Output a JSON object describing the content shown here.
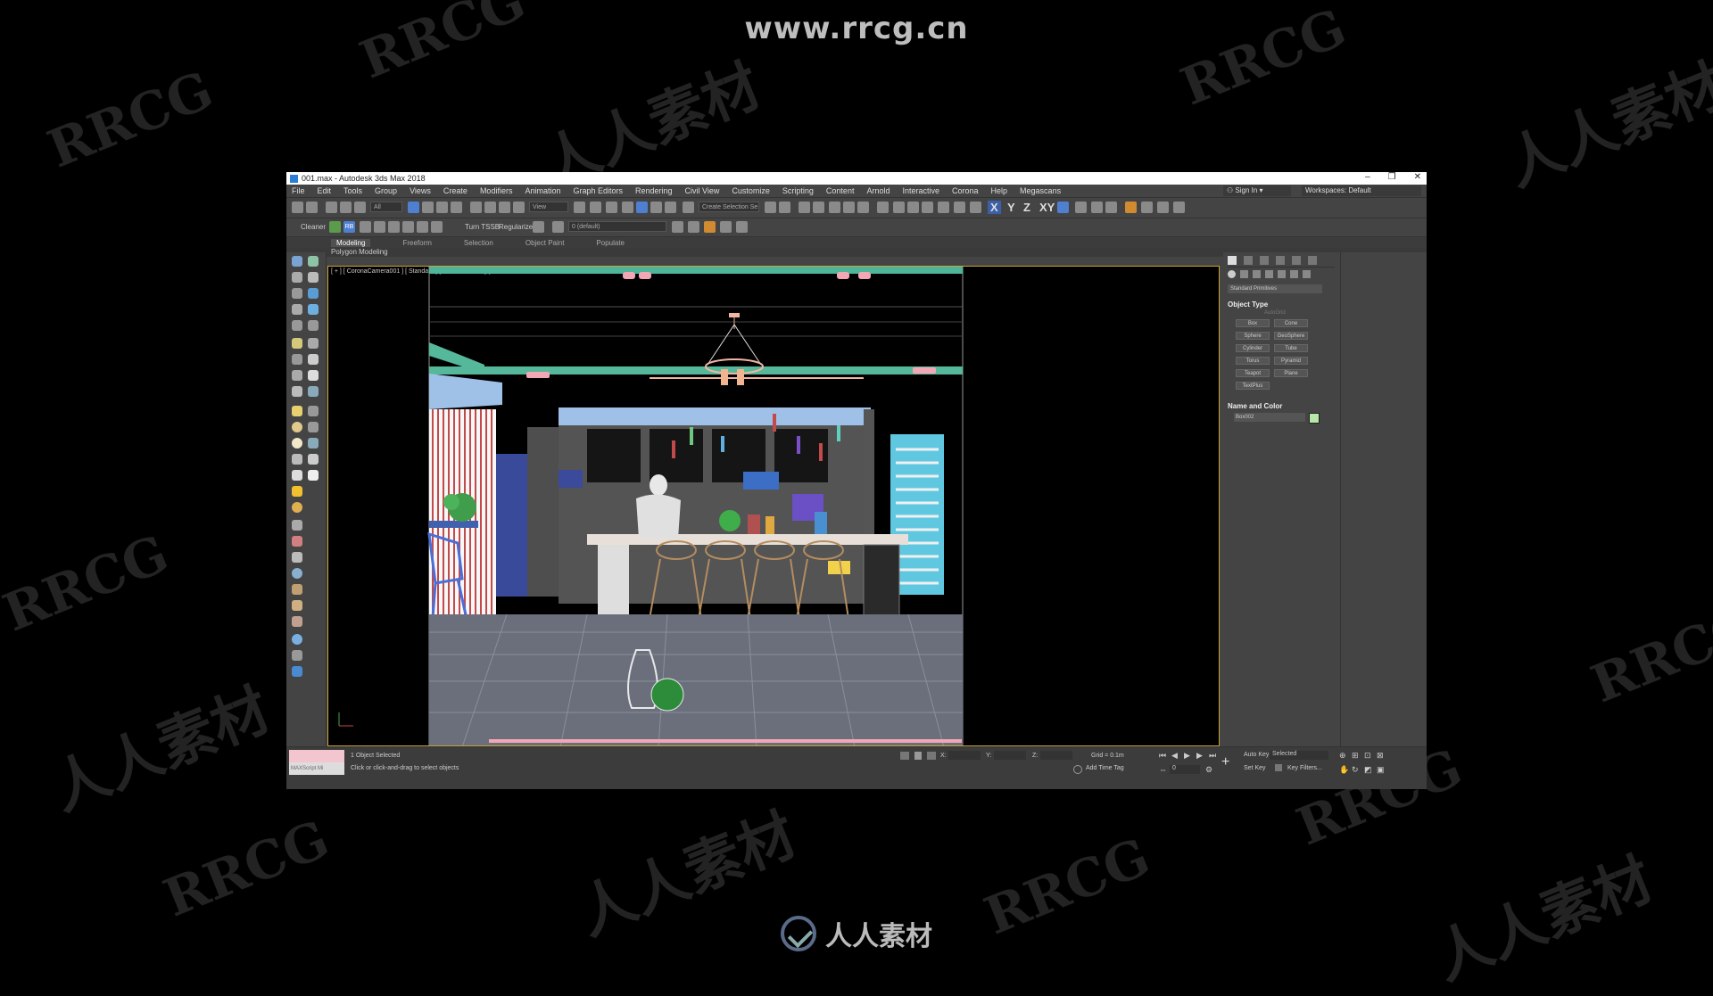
{
  "watermarks": {
    "url": "www.rrcg.cn",
    "brand": "人人素材",
    "rrcg": "RRCG"
  },
  "window": {
    "title": "001.max - Autodesk 3ds Max 2018",
    "controls": [
      "–",
      "❐",
      "✕"
    ]
  },
  "menu": {
    "items": [
      "File",
      "Edit",
      "Tools",
      "Group",
      "Views",
      "Create",
      "Modifiers",
      "Animation",
      "Graph Editors",
      "Rendering",
      "Civil View",
      "Customize",
      "Scripting",
      "Content",
      "Arnold",
      "Interactive",
      "Corona",
      "Help",
      "Megascans"
    ],
    "signin": "Sign In",
    "workspaces_label": "Workspaces:",
    "workspaces_value": "Default"
  },
  "toolbar1": {
    "filter": "All",
    "view": "View",
    "selection_set": "Create Selection Se",
    "axes": [
      "X",
      "Y",
      "Z",
      "XY"
    ]
  },
  "toolbar2": {
    "cleaner": "Cleaner",
    "rb": "RB",
    "turn_tssb": "Turn TSSB",
    "regularize": "Regularize",
    "layer": "0 (default)"
  },
  "ribbon": {
    "tabs": [
      "Modeling",
      "Freeform",
      "Selection",
      "Object Paint",
      "Populate"
    ],
    "sub": "Polygon Modeling"
  },
  "viewport": {
    "label": "[ + ] [ CoronaCamera001 ] [ Standard ] [ Default Shading ]"
  },
  "command_panel": {
    "dropdown": "Standard Primitives",
    "object_type_header": "Object Type",
    "autogrid": "AutoGrid",
    "buttons": [
      "Box",
      "Cone",
      "Sphere",
      "GeoSphere",
      "Cylinder",
      "Tube",
      "Torus",
      "Pyramid",
      "Teapot",
      "Plane",
      "TextPlus"
    ],
    "name_color_header": "Name and Color",
    "name_value": "Box002",
    "swatch_color": "#b7e7a8"
  },
  "status": {
    "maxscript": "MAXScript Mi",
    "selected": "1 Object Selected",
    "hint": "Click or click-and-drag to select objects",
    "x_label": "X:",
    "y_label": "Y:",
    "z_label": "Z:",
    "grid": "Grid = 0.1m",
    "add_time_tag": "Add Time Tag",
    "auto_key": "Auto Key",
    "set_key": "Set Key",
    "selected_dd": "Selected",
    "key_filters": "Key Filters...",
    "frame": "0"
  }
}
